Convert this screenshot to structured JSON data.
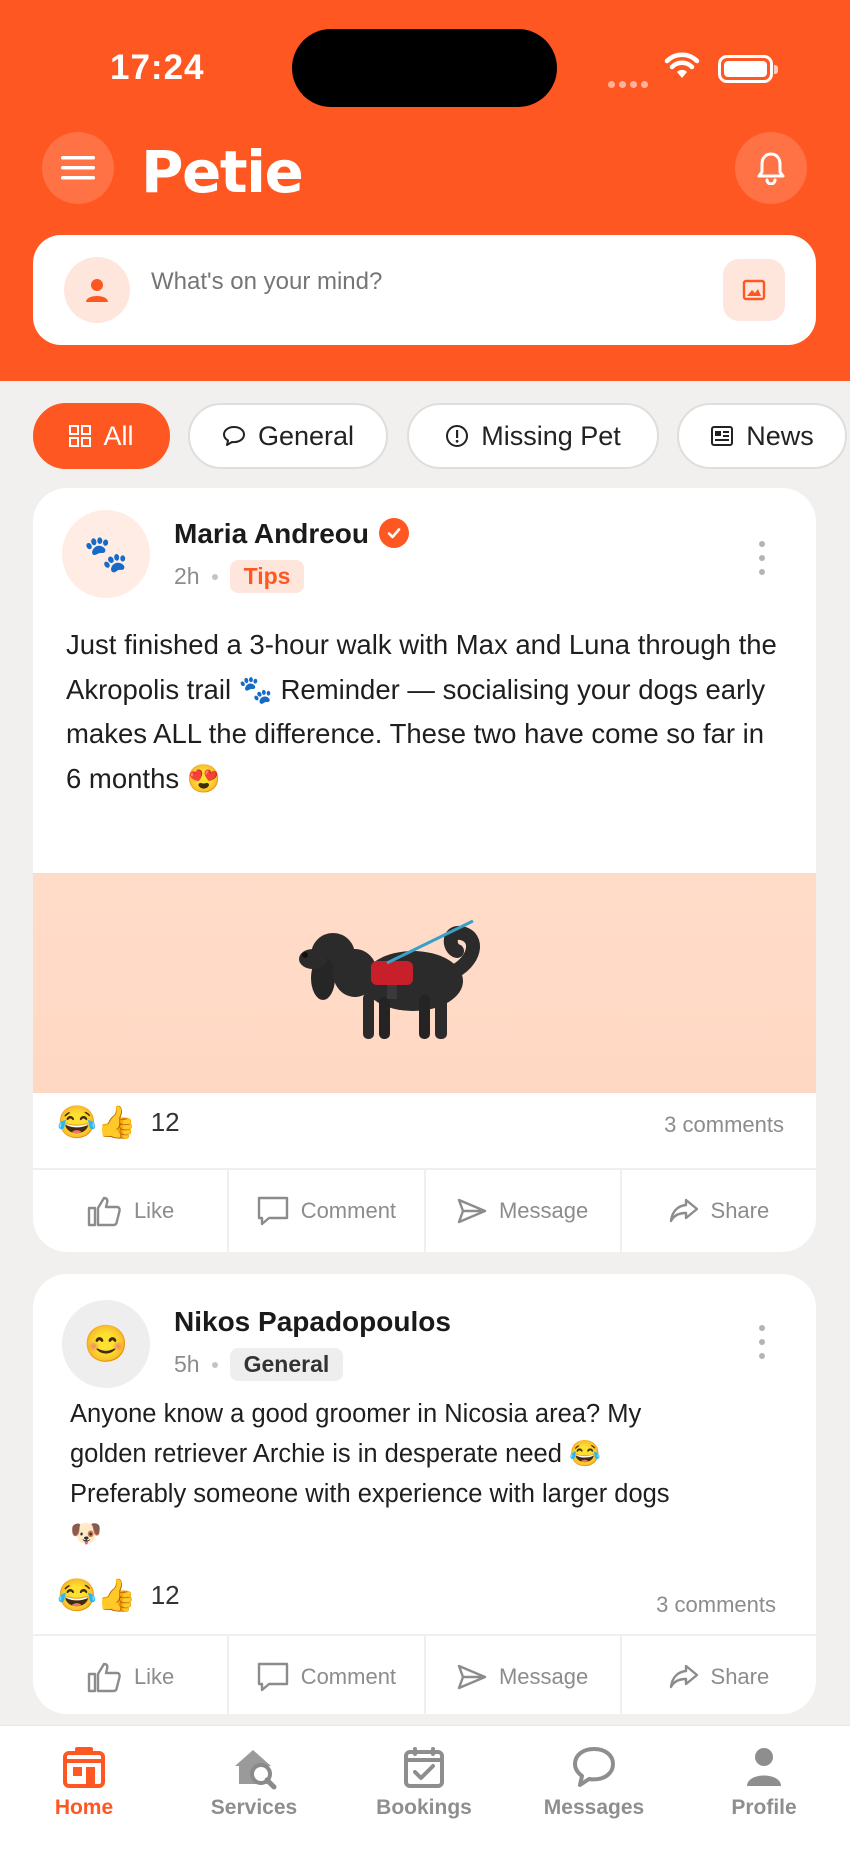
{
  "status_bar": {
    "time": "17:24"
  },
  "app": {
    "title": "Petie",
    "brand_color": "#ff5722"
  },
  "header": {
    "menu_icon": "hamburger-icon",
    "bell_icon": "bell-icon"
  },
  "composer": {
    "placeholder": "What's on your mind?",
    "avatar_icon": "person-icon",
    "photo_icon": "image-icon"
  },
  "filters": [
    {
      "label": "All",
      "icon": "grid-icon",
      "active": true
    },
    {
      "label": "General",
      "icon": "chat-bubble-icon",
      "active": false
    },
    {
      "label": "Missing Pet",
      "icon": "alert-circle-icon",
      "active": false
    },
    {
      "label": "News",
      "icon": "newspaper-icon",
      "active": false
    }
  ],
  "posts": [
    {
      "author": "Maria Andreou",
      "verified": true,
      "time": "2h",
      "tag": "Tips",
      "avatar": "🐾",
      "text": "Just finished a 3-hour walk with Max and Luna through the Akropolis trail 🐾 Reminder — socialising your dogs early makes ALL the difference. These two have come so far in 6 months 😍",
      "reactions": "😂👍",
      "reaction_count": "12",
      "comments": "3 comments"
    },
    {
      "author": "Nikos Papadopoulos",
      "verified": false,
      "time": "5h",
      "tag": "General",
      "avatar": "😊",
      "text": "Anyone know a good groomer in Nicosia area? My golden retriever Archie is in desperate need 😂 Preferably someone with experience with larger dogs 🐶",
      "reactions": "😂👍",
      "reaction_count": "12",
      "comments": "3 comments"
    }
  ],
  "post_actions": {
    "like": "Like",
    "comment": "Comment",
    "message": "Message",
    "share": "Share"
  },
  "bottom_nav": [
    {
      "label": "Home",
      "icon": "home-icon",
      "active": true
    },
    {
      "label": "Services",
      "icon": "services-icon",
      "active": false
    },
    {
      "label": "Bookings",
      "icon": "calendar-icon",
      "active": false
    },
    {
      "label": "Messages",
      "icon": "message-icon",
      "active": false
    },
    {
      "label": "Profile",
      "icon": "profile-icon",
      "active": false
    }
  ]
}
